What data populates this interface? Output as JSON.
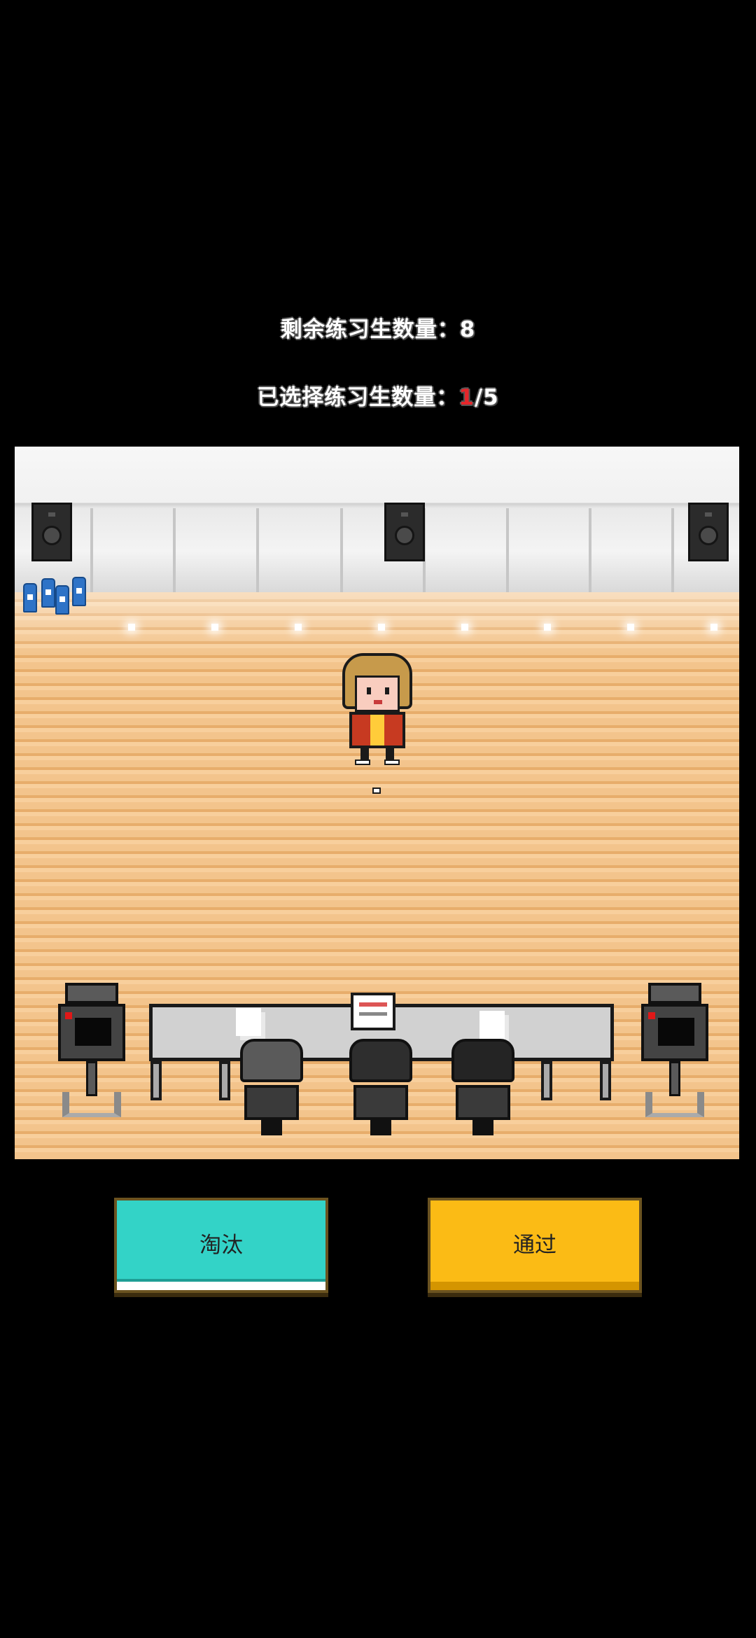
{
  "hud": {
    "remaining_label": "剩余练习生数量：",
    "remaining_count": "8",
    "selected_label": "已选择练习生数量：",
    "selected_current": "1",
    "selected_total": "/5"
  },
  "actions": {
    "eliminate_label": "淘汰",
    "pass_label": "通过"
  },
  "colors": {
    "eliminate_button": "#33d3c7",
    "pass_button": "#fbbb15",
    "highlight": "#e4262b"
  }
}
